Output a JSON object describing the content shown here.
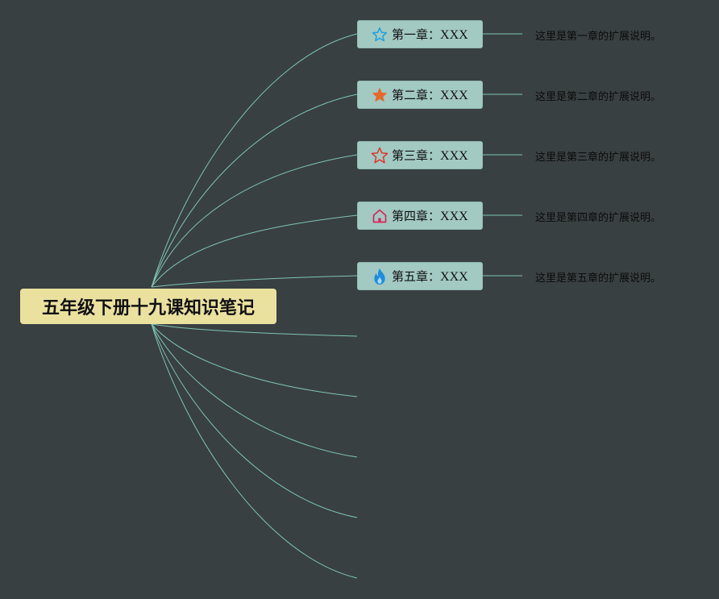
{
  "root": {
    "title": "五年级下册十九课知识笔记"
  },
  "chapters": [
    {
      "label": "第一章：",
      "suffix": "XXX",
      "note": "这里是第一章的扩展说明。",
      "icon": "star-outline-icon",
      "icon_color": "#1ea0e0"
    },
    {
      "label": "第二章：",
      "suffix": "XXX",
      "note": "这里是第二章的扩展说明。",
      "icon": "star-filled-icon",
      "icon_color": "#e8672a"
    },
    {
      "label": "第三章：",
      "suffix": "XXX",
      "note": "这里是第三章的扩展说明。",
      "icon": "star-outline-icon",
      "icon_color": "#e0322a"
    },
    {
      "label": "第四章：",
      "suffix": "XXX",
      "note": "这里是第四章的扩展说明。",
      "icon": "home-icon",
      "icon_color": "#d6265a"
    },
    {
      "label": "第五章：",
      "suffix": "XXX",
      "note": "这里是第五章的扩展说明。",
      "icon": "flame-icon",
      "icon_color": "#1e8de0"
    }
  ],
  "colors": {
    "background": "#394042",
    "root_fill": "#ebe19f",
    "node_fill": "#a2c9c2",
    "connector": "#7fc3b3"
  }
}
